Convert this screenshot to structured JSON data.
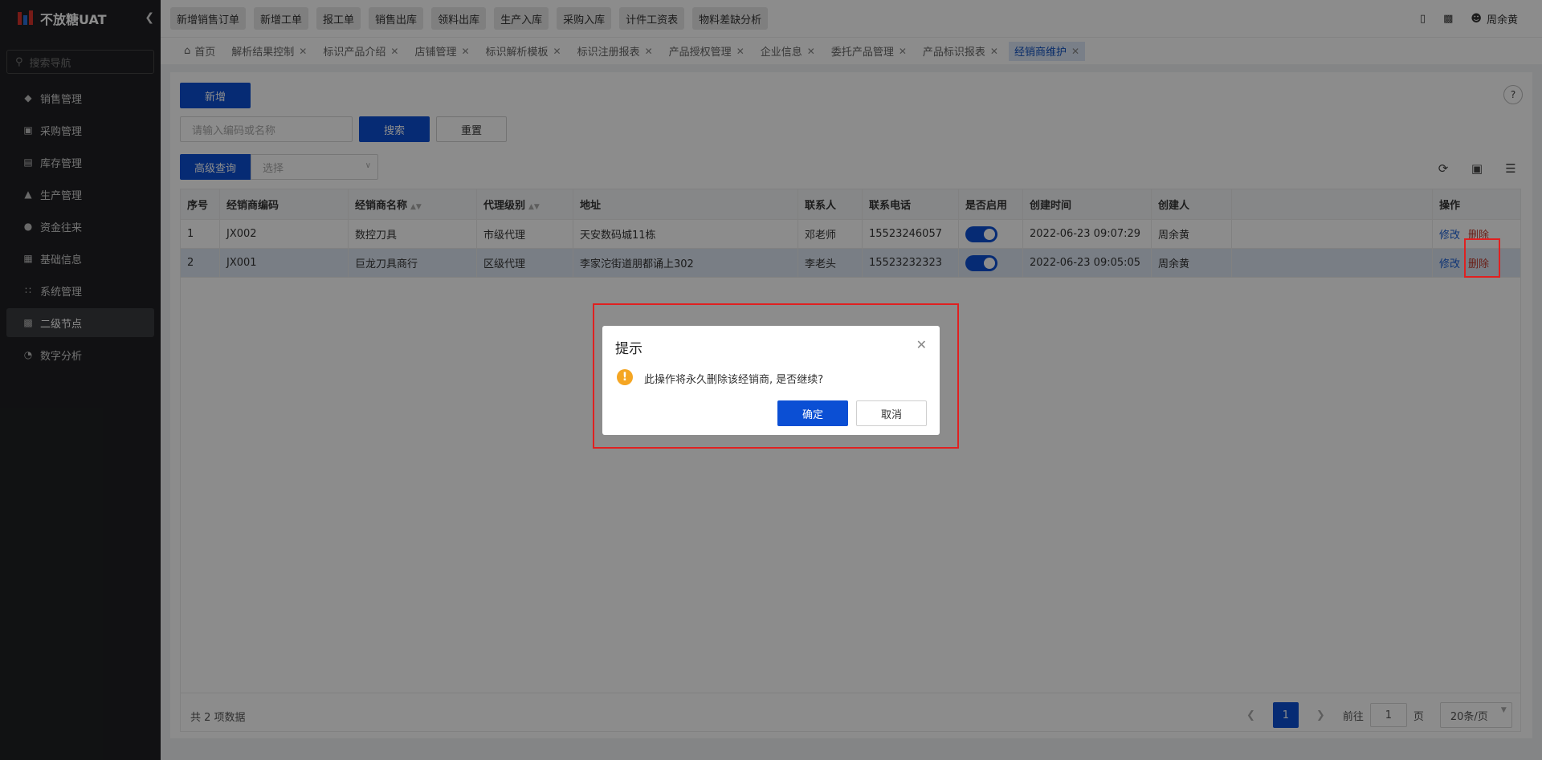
{
  "app": {
    "title": "不放糖UAT"
  },
  "sidebar": {
    "search_placeholder": "搜索导航",
    "items": [
      {
        "label": "销售管理",
        "icon": "tag-icon"
      },
      {
        "label": "采购管理",
        "icon": "cart-icon"
      },
      {
        "label": "库存管理",
        "icon": "box-icon"
      },
      {
        "label": "生产管理",
        "icon": "factory-icon"
      },
      {
        "label": "资金往来",
        "icon": "money-icon"
      },
      {
        "label": "基础信息",
        "icon": "grid-icon"
      },
      {
        "label": "系统管理",
        "icon": "apps-icon"
      },
      {
        "label": "二级节点",
        "icon": "doc-icon"
      },
      {
        "label": "数字分析",
        "icon": "pie-icon"
      }
    ]
  },
  "topbar": {
    "shortcuts": [
      "新增销售订单",
      "新增工单",
      "报工单",
      "销售出库",
      "领料出库",
      "生产入库",
      "采购入库",
      "计件工资表",
      "物料差缺分析"
    ],
    "user": "周余黄"
  },
  "tabs": [
    {
      "label": "首页"
    },
    {
      "label": "解析结果控制"
    },
    {
      "label": "标识产品介绍"
    },
    {
      "label": "店铺管理"
    },
    {
      "label": "标识解析模板"
    },
    {
      "label": "标识注册报表"
    },
    {
      "label": "产品授权管理"
    },
    {
      "label": "企业信息"
    },
    {
      "label": "委托产品管理"
    },
    {
      "label": "产品标识报表"
    },
    {
      "label": "经销商维护"
    }
  ],
  "toolbar": {
    "add_label": "新增",
    "search_placeholder": "请输入编码或名称",
    "search_label": "搜索",
    "reset_label": "重置",
    "advanced_label": "高级查询",
    "select_placeholder": "选择"
  },
  "table": {
    "headers": [
      "序号",
      "经销商编码",
      "经销商名称",
      "代理级别",
      "地址",
      "联系人",
      "联系电话",
      "是否启用",
      "创建时间",
      "创建人",
      "",
      "操作"
    ],
    "rows": [
      {
        "no": "1",
        "code": "JX002",
        "name": "数控刀具",
        "level": "市级代理",
        "address": "天安数码城11栋",
        "contact": "邓老师",
        "phone": "15523246057",
        "enabled": true,
        "created": "2022-06-23 09:07:29",
        "creator": "周余黄",
        "edit": "修改",
        "del": "删除"
      },
      {
        "no": "2",
        "code": "JX001",
        "name": "巨龙刀具商行",
        "level": "区级代理",
        "address": "李家沱街道朋都诵上302",
        "contact": "李老头",
        "phone": "15523232323",
        "enabled": true,
        "created": "2022-06-23 09:05:05",
        "creator": "周余黄",
        "edit": "修改",
        "del": "删除"
      }
    ]
  },
  "footer": {
    "total": "共 2 项数据",
    "page": "1",
    "goto_label": "前往",
    "goto_value": "1",
    "page_suffix": "页",
    "page_size": "20条/页"
  },
  "dialog": {
    "title": "提示",
    "message": "此操作将永久删除该经销商, 是否继续?",
    "ok": "确定",
    "cancel": "取消"
  },
  "colors": {
    "primary": "#0b4fd4",
    "sidebar": "#1f2023",
    "danger": "#e02020",
    "warning": "#f5a623"
  }
}
